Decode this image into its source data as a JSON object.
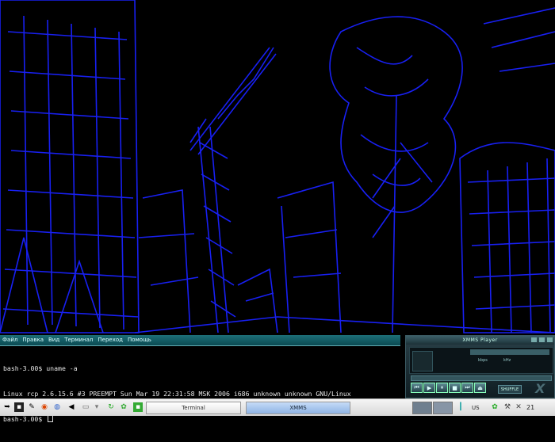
{
  "terminal": {
    "menu": [
      "Файл",
      "Правка",
      "Вид",
      "Терминал",
      "Переход",
      "Помощь"
    ],
    "lines": [
      "bash-3.00$ uname -a",
      "Linux rcp 2.6.15.6 #3 PREEMPT Sun Mar 19 22:31:58 MSK 2006 i686 unknown unknown GNU/Linux",
      "bash-3.00$ "
    ]
  },
  "xmms": {
    "title": "XMMS Player",
    "kbps_label": "kbps",
    "khz_label": "kHz",
    "shuffle_label": "SHUFFLE",
    "logo": "X",
    "controls": [
      "⏮",
      "▶",
      "⏸",
      "■",
      "⏭",
      "⏏"
    ]
  },
  "taskbar": {
    "tasks": [
      "Terminal",
      "XMMS"
    ],
    "language": "US",
    "clock": "21"
  },
  "colors": {
    "wallpaper_line": "#1a1aff",
    "terminal_menubar": "#0f5a63",
    "taskbar_active": "#8fb4e4"
  }
}
